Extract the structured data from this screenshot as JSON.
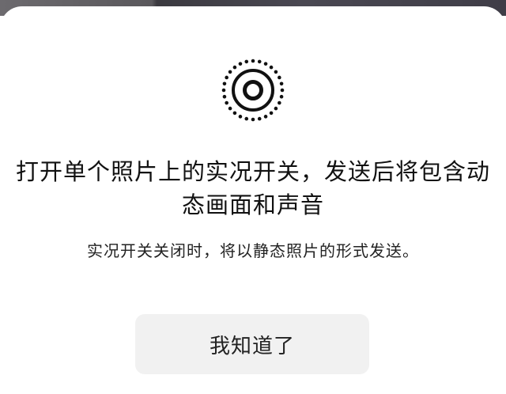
{
  "dialog": {
    "icon": "live-photo-icon",
    "title_line1": "打开单个照片上的实况开关，发送后将包含动",
    "title_line2": "态画面和声音",
    "subtitle": "实况开关关闭时，将以静态照片的形式发送。",
    "confirm_label": "我知道了"
  },
  "colors": {
    "sheet_background": "#ffffff",
    "button_background": "#f1f1f1",
    "text_primary": "#111111"
  }
}
